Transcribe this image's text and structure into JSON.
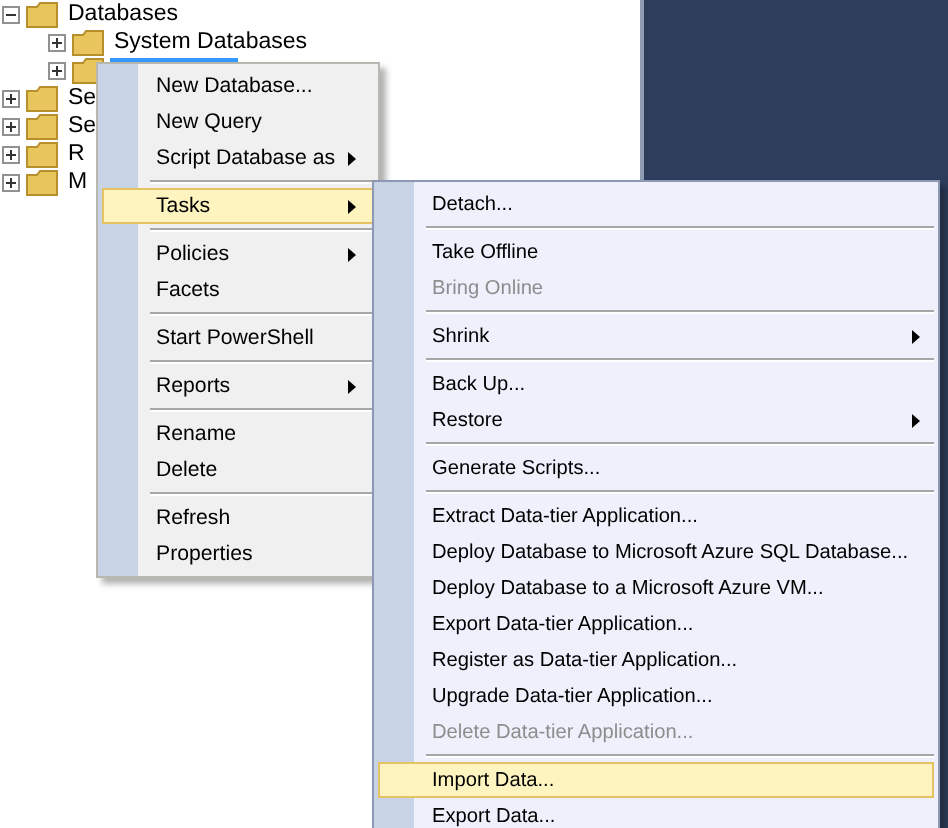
{
  "tree": [
    {
      "label": "Databases",
      "expanded": true,
      "selected": false,
      "children": [
        {
          "label": "System Databases",
          "expanded": false,
          "selected": false
        },
        {
          "expanded": false,
          "selected": true
        }
      ]
    },
    {
      "label": "Se",
      "expanded": false,
      "selected": false
    },
    {
      "label": "Se",
      "expanded": false,
      "selected": false
    },
    {
      "label": "R",
      "expanded": false,
      "selected": false
    },
    {
      "label": "M",
      "expanded": false,
      "selected": false
    }
  ],
  "context_menu": {
    "sections": [
      [
        {
          "label": "New Database...",
          "submenu": false,
          "selected": false,
          "disabled": false
        },
        {
          "label": "New Query",
          "submenu": false,
          "selected": false,
          "disabled": false
        },
        {
          "label": "Script Database as",
          "submenu": true,
          "selected": false,
          "disabled": false
        }
      ],
      [
        {
          "label": "Tasks",
          "submenu": true,
          "selected": true,
          "disabled": false
        }
      ],
      [
        {
          "label": "Policies",
          "submenu": true,
          "selected": false,
          "disabled": false
        },
        {
          "label": "Facets",
          "submenu": false,
          "selected": false,
          "disabled": false
        }
      ],
      [
        {
          "label": "Start PowerShell",
          "submenu": false,
          "selected": false,
          "disabled": false
        }
      ],
      [
        {
          "label": "Reports",
          "submenu": true,
          "selected": false,
          "disabled": false
        }
      ],
      [
        {
          "label": "Rename",
          "submenu": false,
          "selected": false,
          "disabled": false
        },
        {
          "label": "Delete",
          "submenu": false,
          "selected": false,
          "disabled": false
        }
      ],
      [
        {
          "label": "Refresh",
          "submenu": false,
          "selected": false,
          "disabled": false
        },
        {
          "label": "Properties",
          "submenu": false,
          "selected": false,
          "disabled": false
        }
      ]
    ]
  },
  "tasks_submenu": {
    "sections": [
      [
        {
          "label": "Detach...",
          "submenu": false,
          "selected": false,
          "disabled": false
        }
      ],
      [
        {
          "label": "Take Offline",
          "submenu": false,
          "selected": false,
          "disabled": false
        },
        {
          "label": "Bring Online",
          "submenu": false,
          "selected": false,
          "disabled": true
        }
      ],
      [
        {
          "label": "Shrink",
          "submenu": true,
          "selected": false,
          "disabled": false
        }
      ],
      [
        {
          "label": "Back Up...",
          "submenu": false,
          "selected": false,
          "disabled": false
        },
        {
          "label": "Restore",
          "submenu": true,
          "selected": false,
          "disabled": false
        }
      ],
      [
        {
          "label": "Generate Scripts...",
          "submenu": false,
          "selected": false,
          "disabled": false
        }
      ],
      [
        {
          "label": "Extract Data-tier Application...",
          "submenu": false,
          "selected": false,
          "disabled": false
        },
        {
          "label": "Deploy Database to Microsoft Azure SQL Database...",
          "submenu": false,
          "selected": false,
          "disabled": false
        },
        {
          "label": "Deploy Database to a Microsoft Azure VM...",
          "submenu": false,
          "selected": false,
          "disabled": false
        },
        {
          "label": "Export Data-tier Application...",
          "submenu": false,
          "selected": false,
          "disabled": false
        },
        {
          "label": "Register as Data-tier Application...",
          "submenu": false,
          "selected": false,
          "disabled": false
        },
        {
          "label": "Upgrade Data-tier Application...",
          "submenu": false,
          "selected": false,
          "disabled": false
        },
        {
          "label": "Delete Data-tier Application...",
          "submenu": false,
          "selected": false,
          "disabled": true
        }
      ],
      [
        {
          "label": "Import Data...",
          "submenu": false,
          "selected": true,
          "disabled": false
        },
        {
          "label": "Export Data...",
          "submenu": false,
          "selected": false,
          "disabled": false
        }
      ]
    ]
  }
}
